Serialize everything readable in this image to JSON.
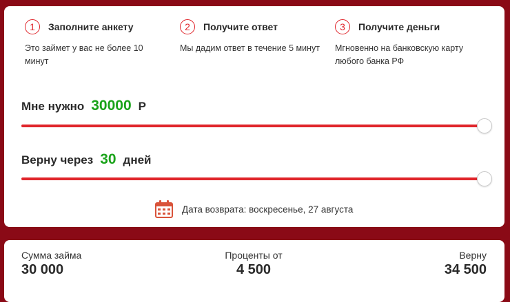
{
  "steps": [
    {
      "number": "1",
      "title": "Заполните анкету",
      "description": "Это займет у вас не более 10 минут"
    },
    {
      "number": "2",
      "title": "Получите ответ",
      "description": "Мы дадим ответ в течение 5 минут"
    },
    {
      "number": "3",
      "title": "Получите деньги",
      "description": "Мгновенно на банковскую карту любого банка РФ"
    }
  ],
  "amount_slider": {
    "label": "Мне нужно",
    "value": "30000",
    "unit": "Р",
    "level_fraction": 1.0
  },
  "term_slider": {
    "label": "Верну через",
    "value": "30",
    "unit": "дней",
    "level_fraction": 1.0
  },
  "return_date": {
    "text": "Дата возврата: воскресенье, 27 августа",
    "icon": "calendar-icon"
  },
  "summary": {
    "loan_label": "Сумма займа",
    "loan_value": "30 000",
    "interest_label": "Проценты от",
    "interest_value": "4 500",
    "repay_label": "Верну",
    "repay_value": "34 500"
  },
  "colors": {
    "background": "#8a0a16",
    "accent": "#e0252b",
    "value_green": "#1aa31a"
  }
}
